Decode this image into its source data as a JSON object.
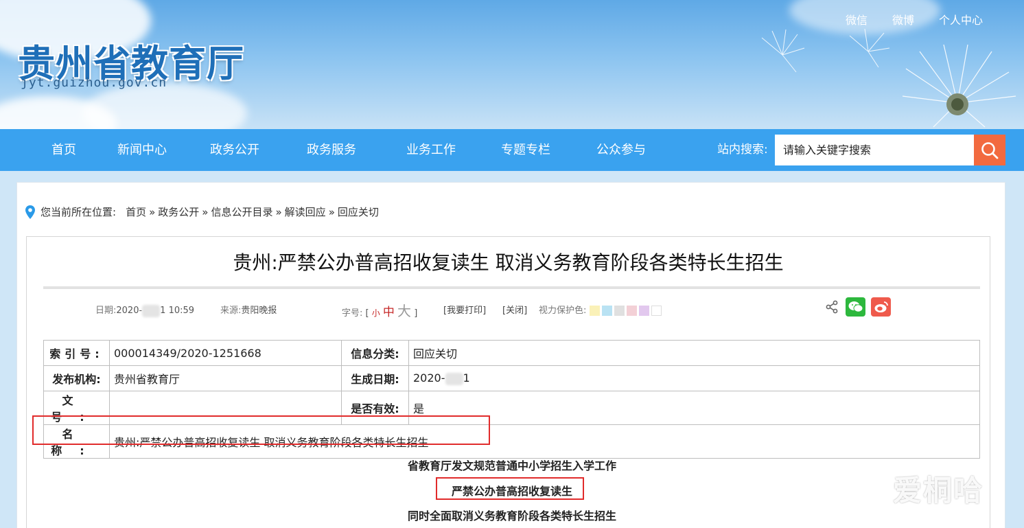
{
  "header": {
    "site_title": "贵州省教育厅",
    "site_url": "jyt.guizhou.gov.cn",
    "top_links": [
      "微信",
      "微博",
      "个人中心"
    ]
  },
  "nav": {
    "items": [
      "首页",
      "新闻中心",
      "政务公开",
      "政务服务",
      "业务工作",
      "专题专栏",
      "公众参与"
    ],
    "search_label": "站内搜索:",
    "search_placeholder": "请输入关键字搜索"
  },
  "breadcrumb": {
    "label": "您当前所在位置:",
    "items": [
      "首页",
      "政务公开",
      "信息公开目录",
      "解读回应",
      "回应关切"
    ],
    "separator": "»"
  },
  "article": {
    "title": "贵州:严禁公办普高招收复读生 取消义务教育阶段各类特长生招生",
    "meta": {
      "date_label": "日期:",
      "date_prefix": "2020-",
      "date_suffix": "1 10:59",
      "source_label": "来源:",
      "source": "贵阳晚报",
      "font_label": "字号:",
      "bracket_open": "[",
      "font_small": "小",
      "font_mid": "中",
      "font_big": "大",
      "bracket_close": "]",
      "print": "[我要打印]",
      "close": "[关闭]",
      "eye_label": "视力保护色:",
      "swatch_colors": [
        "#faf1b8",
        "#b9e2f3",
        "#e0e0e0",
        "#f3d0d6",
        "#e2c8ee",
        "#ffffff"
      ]
    },
    "info": {
      "index_label": "索引号:",
      "index_value": "000014349/2020-1251668",
      "category_label": "信息分类:",
      "category_value": "回应关切",
      "publisher_label": "发布机构:",
      "publisher_value": "贵州省教育厅",
      "gen_date_label": "生成日期:",
      "gen_date_prefix": "2020-",
      "gen_date_suffix": "1",
      "doc_no_label": "文号:",
      "doc_no_value": "",
      "valid_label": "是否有效:",
      "valid_value": "是",
      "name_label": "名称:",
      "name_value": "贵州:严禁公办普高招收复读生 取消义务教育阶段各类特长生招生"
    },
    "body_lines": [
      "省教育厅发文规范普通中小学招生入学工作",
      "严禁公办普高招收复读生",
      "同时全面取消义务教育阶段各类特长生招生"
    ]
  },
  "watermark": "爱桐哈",
  "colors": {
    "nav_bg": "#3aa2ef",
    "search_button": "#f26a3f",
    "highlight_box": "#e12b2b",
    "wechat": "#2db83d",
    "weibo": "#ef5a4c"
  }
}
